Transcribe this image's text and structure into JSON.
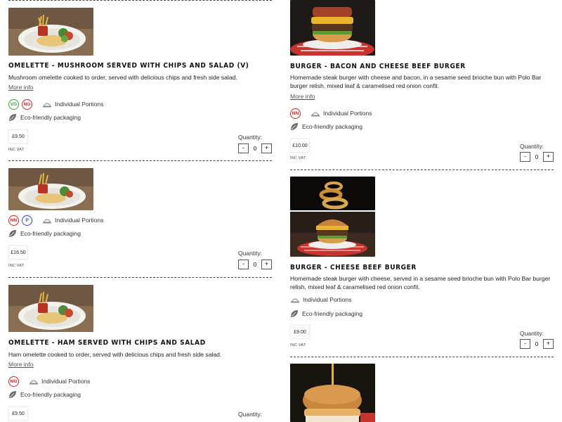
{
  "labels": {
    "quantity": "Quantity:",
    "inc_vat": "INC VAT",
    "more_info": "More info",
    "individual_portions": "Individual Portions",
    "eco_packaging": "Eco-friendly packaging",
    "minus": "-",
    "plus": "+"
  },
  "colors": {
    "vg": "#39a02c",
    "ng": "#d52020",
    "nn": "#d52020",
    "p": "#2a4ac4",
    "leaf": "#6b6b6b"
  },
  "left_items": [
    {
      "title": "",
      "description": "",
      "badges": [],
      "price": "",
      "quantity": "0"
    },
    {
      "title": "Omelette - Mushroom served with chips and salad (V)",
      "description": "Mushroom omelette cooked to order, served with delicious chips and fresh side salad.",
      "badges": [
        "VG",
        "NG"
      ],
      "price": "£9.50",
      "quantity": "0"
    },
    {
      "title": "",
      "description": "",
      "badges": [
        "NN",
        "P"
      ],
      "price": "£16.50",
      "quantity": "0"
    },
    {
      "title": "Omelette - Ham served with chips and salad",
      "description": "Ham omelette cooked to order, served with delicious chips and fresh side salad.",
      "badges": [
        "NG"
      ],
      "price": "£9.50",
      "quantity": "0"
    }
  ],
  "right_items": [
    {
      "title": "Burger - Bacon and Cheese Beef Burger",
      "description": "Homemade steak burger with cheese and bacon, in a sesame seed brioche bun with Polo Bar burger relish, mixed leaf & caramelised red onion confit.",
      "badges": [
        "NN"
      ],
      "price": "£10.00",
      "quantity": "0"
    },
    {
      "title": "Burger - Cheese Beef Burger",
      "description": "Homemade steak burger with cheese, served in a sesame seed brioche bun with Polo Bar burger relish, mixed leaf & caramelised red onion confit.",
      "badges": [],
      "price": "£9.00",
      "quantity": "0"
    }
  ]
}
